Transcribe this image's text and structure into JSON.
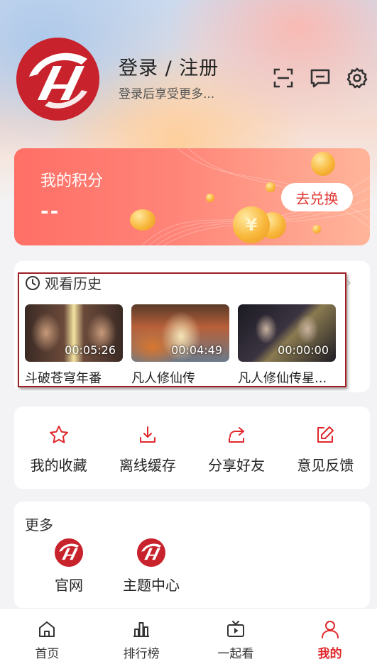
{
  "header": {
    "title": "登录 / 注册",
    "subtitle": "登录后享受更多..."
  },
  "icons": {
    "scan": "scan-icon",
    "message": "message-icon",
    "settings": "gear-icon"
  },
  "points": {
    "title": "我的积分",
    "value": "--",
    "redeem_label": "去兑换"
  },
  "history": {
    "title": "观看历史",
    "items": [
      {
        "name": "斗破苍穹年番",
        "time": "00:05:26"
      },
      {
        "name": "凡人修仙传",
        "time": "00:04:49"
      },
      {
        "name": "凡人修仙传星...",
        "time": "00:00:00"
      }
    ]
  },
  "actions": [
    {
      "label": "我的收藏",
      "icon": "star-icon"
    },
    {
      "label": "离线缓存",
      "icon": "download-icon"
    },
    {
      "label": "分享好友",
      "icon": "share-icon"
    },
    {
      "label": "意见反馈",
      "icon": "edit-icon"
    }
  ],
  "more": {
    "title": "更多",
    "items": [
      {
        "label": "官网"
      },
      {
        "label": "主题中心"
      }
    ]
  },
  "tabbar": [
    {
      "label": "首页",
      "icon": "home-icon",
      "active": false
    },
    {
      "label": "排行榜",
      "icon": "ranking-icon",
      "active": false
    },
    {
      "label": "一起看",
      "icon": "tv-icon",
      "active": false
    },
    {
      "label": "我的",
      "icon": "user-icon",
      "active": true
    }
  ],
  "colors": {
    "accent": "#e0282c",
    "brand": "#c8232c"
  }
}
